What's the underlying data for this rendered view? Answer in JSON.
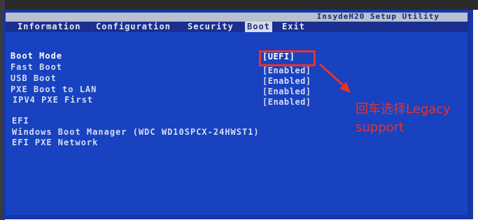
{
  "bios": {
    "title": "InsydeH20 Setup Utility",
    "menu": [
      {
        "label": "Information"
      },
      {
        "label": "Configuration"
      },
      {
        "label": "Security"
      },
      {
        "label": "Boot"
      },
      {
        "label": "Exit"
      }
    ],
    "settings": [
      {
        "label": "Boot Mode",
        "value": "[UEFI]"
      },
      {
        "label": "Fast Boot",
        "value": "[Enabled]"
      },
      {
        "label": "USB Boot",
        "value": "[Enabled]"
      },
      {
        "label": "PXE Boot to LAN",
        "value": "[Enabled]"
      },
      {
        "label": "IPV4 PXE First",
        "value": "[Enabled]"
      }
    ],
    "efi_heading": "EFI",
    "efi_items": [
      {
        "label": "Windows Boot Manager (WDC WD10SPCX-24HWST1)"
      },
      {
        "label": "EFI PXE Network"
      }
    ]
  },
  "annotation": {
    "text": "回车选择Legacy support",
    "color": "#e8322a"
  },
  "colors": {
    "background": "#1842c0",
    "menu_bar": "#1a2f8f",
    "title_bar": "#b9c0cf",
    "text": "#d6dcef"
  }
}
